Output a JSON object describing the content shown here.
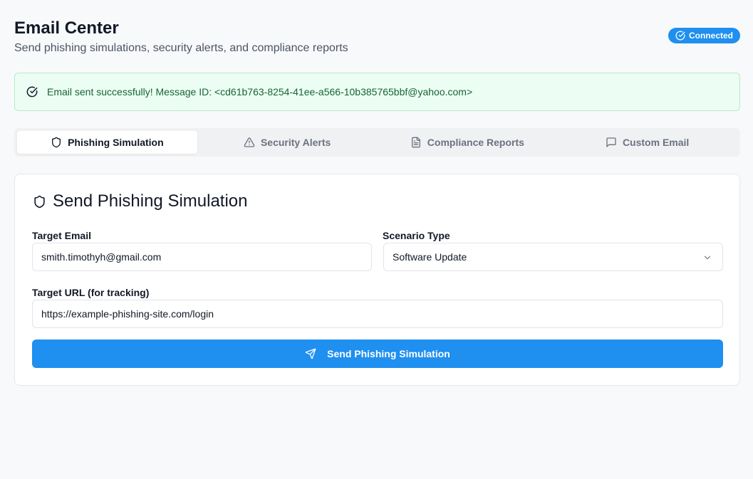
{
  "header": {
    "title": "Email Center",
    "subtitle": "Send phishing simulations, security alerts, and compliance reports",
    "status": "Connected"
  },
  "alert": {
    "message": "Email sent successfully! Message ID: <cd61b763-8254-41ee-a566-10b385765bbf@yahoo.com>"
  },
  "tabs": [
    {
      "label": "Phishing Simulation",
      "icon": "shield-icon",
      "active": true
    },
    {
      "label": "Security Alerts",
      "icon": "warning-triangle-icon",
      "active": false
    },
    {
      "label": "Compliance Reports",
      "icon": "document-icon",
      "active": false
    },
    {
      "label": "Custom Email",
      "icon": "message-icon",
      "active": false
    }
  ],
  "form": {
    "title": "Send Phishing Simulation",
    "target_email_label": "Target Email",
    "target_email_value": "smith.timothyh@gmail.com",
    "scenario_label": "Scenario Type",
    "scenario_value": "Software Update",
    "target_url_label": "Target URL (for tracking)",
    "target_url_value": "https://example-phishing-site.com/login",
    "submit_label": "Send Phishing Simulation"
  },
  "colors": {
    "accent": "#1f8ff0",
    "success_bg": "#ecfdf3",
    "success_text": "#166534"
  }
}
